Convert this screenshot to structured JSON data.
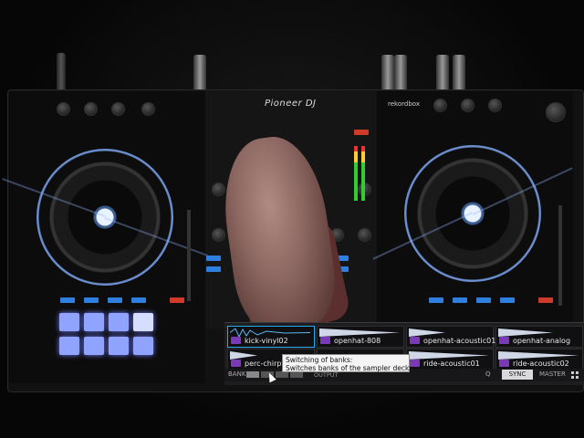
{
  "hardware": {
    "brand": "Pioneer DJ",
    "software_brand": "rekordbox"
  },
  "sampler": {
    "slots": [
      {
        "name": "kick-vinyl02",
        "active": true
      },
      {
        "name": "openhat-808",
        "active": false
      },
      {
        "name": "openhat-acoustic01",
        "active": false
      },
      {
        "name": "openhat-analog",
        "active": false
      },
      {
        "name": "perc-chirpy",
        "active": false
      },
      {
        "name": "",
        "active": false
      },
      {
        "name": "ride-acoustic01",
        "active": false
      },
      {
        "name": "ride-acoustic02",
        "active": false
      }
    ],
    "bank_label": "BANK",
    "output_label": "OUTPUT",
    "q_label": "Q",
    "sync_label": "SYNC",
    "master_label": "MASTER"
  },
  "tooltip": {
    "title": "Switching of banks:",
    "body": "Switches banks of the sampler deck."
  },
  "colors": {
    "pad": "#8fa3ff",
    "slot_tag": "#7a3ab8",
    "active_border": "#2aa8f0",
    "jog_ring": "#6c8fd0"
  }
}
